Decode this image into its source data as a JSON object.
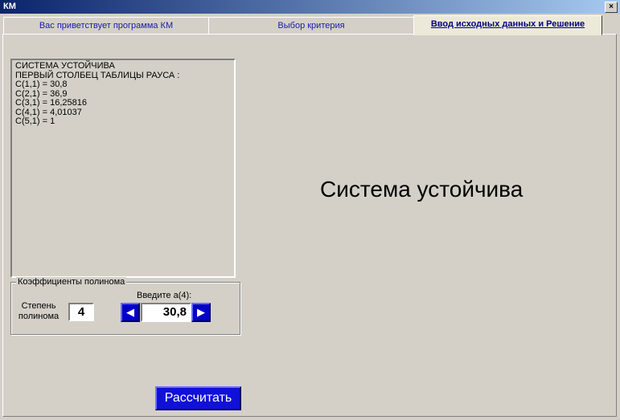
{
  "window": {
    "title": "КМ",
    "close_label": "×"
  },
  "tabs": [
    {
      "label": "Вас приветствует программа КМ"
    },
    {
      "label": "Выбор критерия"
    },
    {
      "label": "Ввод исходных данных и Решение"
    }
  ],
  "memo": {
    "lines": [
      "СИСТЕМА УСТОЙЧИВА",
      "ПЕРВЫЙ СТОЛБЕЦ ТАБЛИЦЫ РАУСА :",
      "C(1,1) = 30,8",
      "C(2,1) = 36,9",
      "C(3,1) = 16,25816",
      "C(4,1) = 4,01037",
      "C(5,1) = 1"
    ]
  },
  "coefficients": {
    "legend": "Коэффициенты полинома",
    "degree_label": "Степень полинома",
    "degree_value": "4",
    "enter_label": "Введите a(4):",
    "coef_value": "30,8",
    "prev_icon": "left-arrow-icon",
    "next_icon": "right-arrow-icon"
  },
  "status": {
    "text": "Система устойчива"
  },
  "actions": {
    "calculate_label": "Рассчитать"
  },
  "colors": {
    "accent_button": "#1010d8",
    "tab_text": "#1a1aa8"
  }
}
